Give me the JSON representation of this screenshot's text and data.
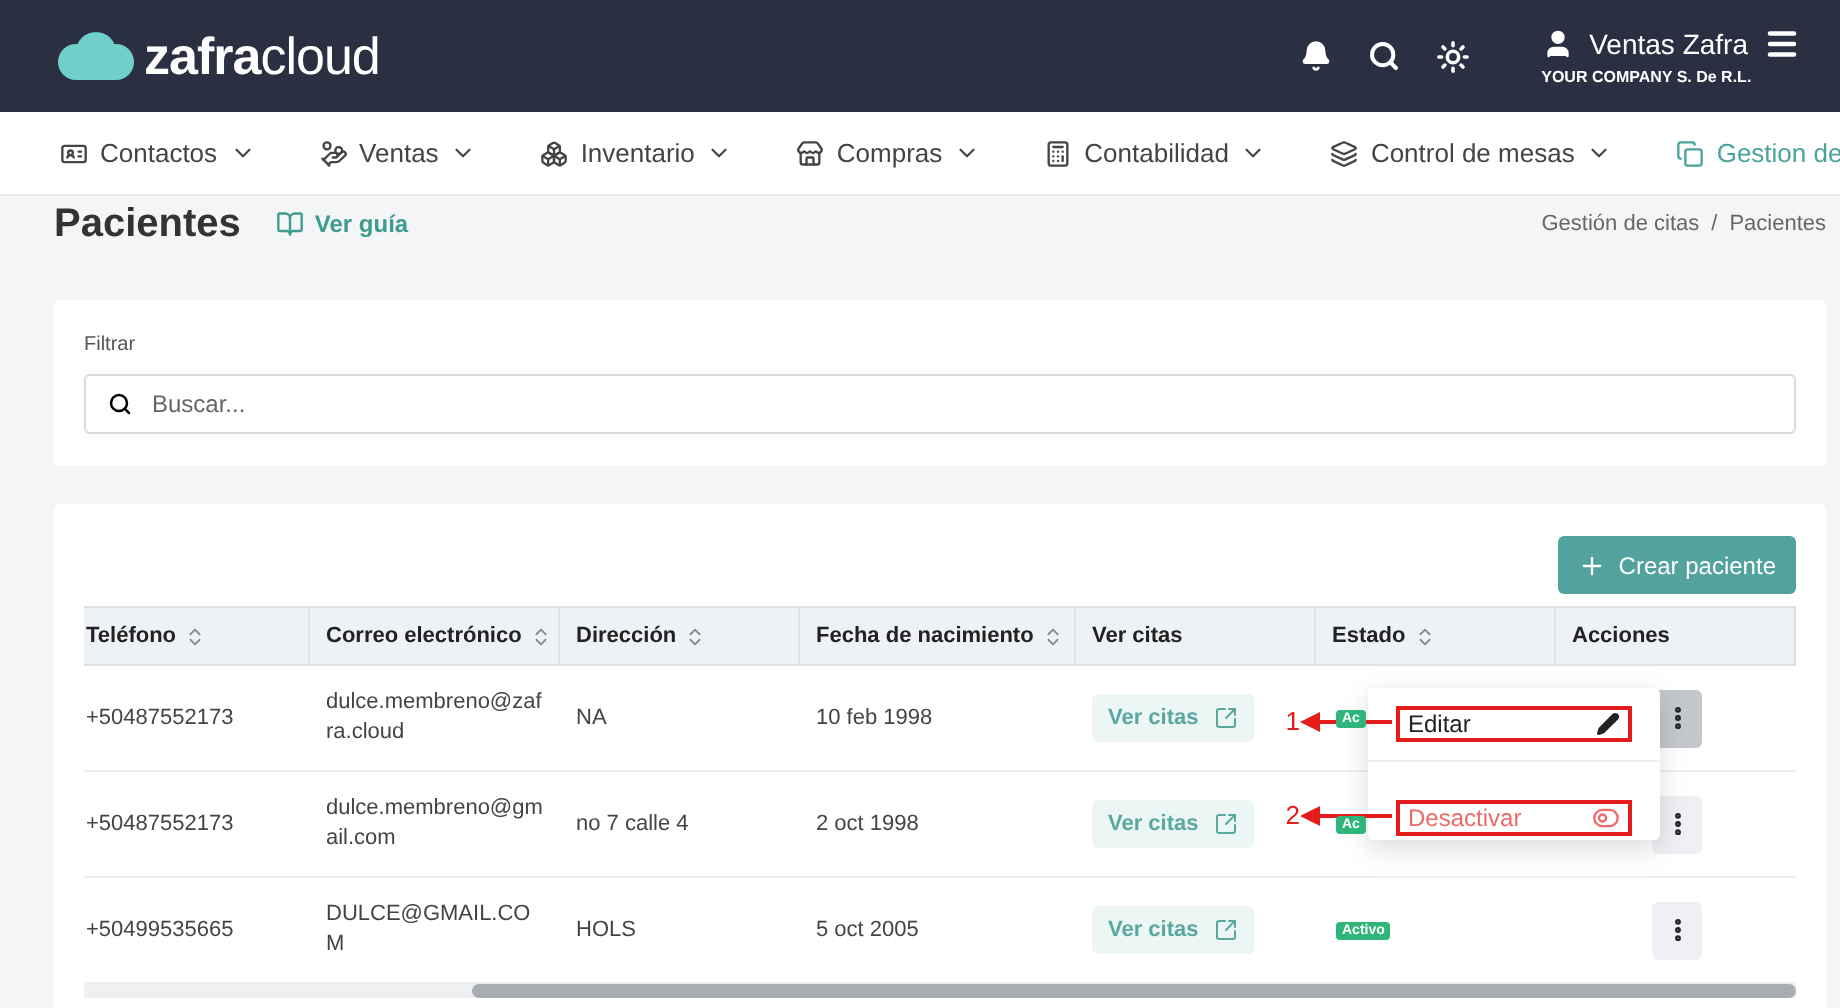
{
  "header": {
    "logo": "**zafra**cloud",
    "user": "Ventas Zafra",
    "company": "YOUR COMPANY S. De R.L."
  },
  "nav": [
    {
      "label": "Contactos",
      "dropdown": true,
      "selected": false
    },
    {
      "label": "Ventas",
      "dropdown": true,
      "selected": false
    },
    {
      "label": "Inventario",
      "dropdown": true,
      "selected": false
    },
    {
      "label": "Compras",
      "dropdown": true,
      "selected": false
    },
    {
      "label": "Contabilidad",
      "dropdown": true,
      "selected": false
    },
    {
      "label": "Control de mesas",
      "dropdown": true,
      "selected": false
    },
    {
      "label": "Gestion de",
      "dropdown": false,
      "selected": true
    }
  ],
  "page": {
    "title": "Pacientes",
    "guide_link": "Ver guía",
    "breadcrumb": [
      "Gestión de citas",
      "Pacientes"
    ],
    "breadcrumb_separator": "/"
  },
  "filter": {
    "label": "Filtrar",
    "placeholder": "Buscar..."
  },
  "create_button": "Crear paciente",
  "table": {
    "columns": [
      {
        "label": "Teléfono",
        "sortable": true
      },
      {
        "label": "Correo electrónico",
        "sortable": true
      },
      {
        "label": "Dirección",
        "sortable": true
      },
      {
        "label": "Fecha de nacimiento",
        "sortable": true
      },
      {
        "label": "Ver citas",
        "sortable": false
      },
      {
        "label": "Estado",
        "sortable": true
      },
      {
        "label": "Acciones",
        "sortable": false
      }
    ],
    "rows": [
      {
        "phone": "+50487552173",
        "email": "dulce.membreno@zafra.cloud",
        "address": "NA",
        "birth": "10 feb 1998",
        "link": "Ver citas",
        "status": "Ac",
        "menu_open": true
      },
      {
        "phone": "+50487552173",
        "email": "dulce.membreno@gmail.com",
        "address": "no 7 calle 4",
        "birth": "2 oct 1998",
        "link": "Ver citas",
        "status": "Ac",
        "menu_open": false
      },
      {
        "phone": "+50499535665",
        "email": "DULCE@GMAIL.COM",
        "address": "HOLS",
        "birth": "5 oct 2005",
        "link": "Ver citas",
        "status": "Activo",
        "menu_open": false
      }
    ]
  },
  "action_menu": [
    {
      "label": "Editar",
      "kind": "edit",
      "annotation": "1"
    },
    {
      "label": "Desactivar",
      "kind": "deactivate",
      "annotation": "2"
    }
  ]
}
